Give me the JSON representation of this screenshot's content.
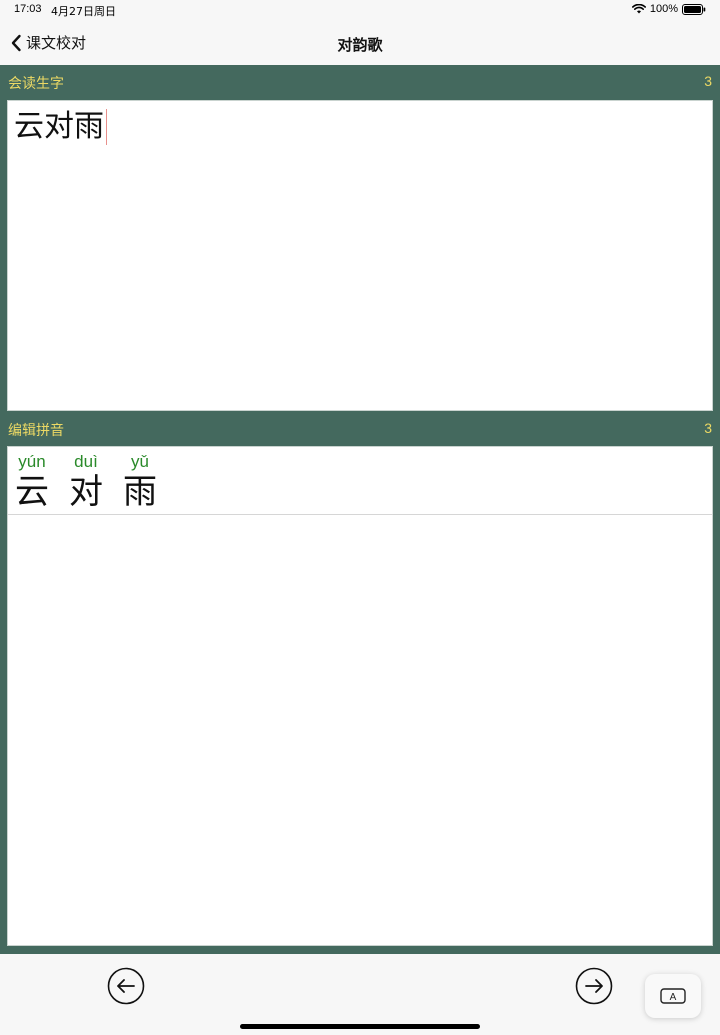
{
  "status_bar": {
    "time": "17:03",
    "date": "4月27日周日",
    "battery": "100%"
  },
  "nav": {
    "back_label": "课文校对",
    "title": "对韵歌"
  },
  "section_read": {
    "label": "会读生字",
    "count": "3",
    "text": "云对雨"
  },
  "section_pinyin": {
    "label": "编辑拼音",
    "count": "3",
    "chars": [
      {
        "pinyin": "yún",
        "hanzi": "云"
      },
      {
        "pinyin": "duì",
        "hanzi": "对"
      },
      {
        "pinyin": "yǔ",
        "hanzi": "雨"
      }
    ]
  },
  "toolbar": {
    "prev_icon": "arrow-left-circle-icon",
    "next_icon": "arrow-right-circle-icon",
    "keyboard_key": "A"
  },
  "colors": {
    "section_bg": "#44695e",
    "section_label": "#ecd964",
    "pinyin": "#2a8a2a"
  }
}
